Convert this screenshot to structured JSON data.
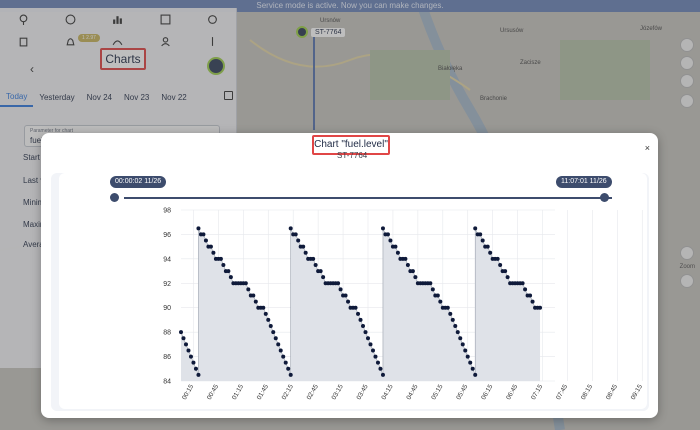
{
  "banner": {
    "text": "Service mode is active. Now you can make changes."
  },
  "map": {
    "labels": [
      "Józefów",
      "Ursnów",
      "Ursusów",
      "Ursów",
      "Ursów Ozarów",
      "Białołęka",
      "Zacisze",
      "Brachonie",
      "Zalesie",
      "Radzymin"
    ],
    "zoom_label": "Zoom"
  },
  "vehicle": {
    "label": "ST-7764"
  },
  "panel": {
    "badge": "1 2.97",
    "title": "Charts",
    "tabs": [
      "Today",
      "Yesterday",
      "Nov 24",
      "Nov 23",
      "Nov 22"
    ],
    "param_label": "Parameter for chart",
    "param_value": "fuel.level",
    "stats": [
      "Start v",
      "Last v",
      "Minim",
      "Maxim",
      "Avera"
    ]
  },
  "modal": {
    "title": "Chart \"fuel.level\"",
    "subtitle": "ST-7764",
    "close": "×",
    "range_start": "00:00:02 11/26",
    "range_end": "11:07:01 11/26"
  },
  "colors": {
    "accent": "#2d77e0",
    "highlight": "#e04646",
    "navy": "#3d4c6d",
    "series": "#0f1a3a",
    "fill": "#dfe2e8"
  },
  "chart_data": {
    "type": "scatter",
    "title": "",
    "xlabel": "",
    "ylabel": "",
    "ylim": [
      84,
      98
    ],
    "yticks": [
      84,
      86,
      88,
      90,
      92,
      94,
      96,
      98
    ],
    "xticks": [
      "00:15",
      "00:45",
      "01:15",
      "01:45",
      "02:15",
      "02:45",
      "03:15",
      "03:45",
      "04:15",
      "04:45",
      "05:15",
      "05:45",
      "06:15",
      "06:45",
      "07:15",
      "07:45",
      "08:15",
      "08:45",
      "09:15",
      "09:45",
      "10:15",
      "10:45"
    ],
    "x_unit": "minutes from 00:00",
    "series": [
      {
        "name": "",
        "points": [
          [
            0,
            88
          ],
          [
            3,
            87.5
          ],
          [
            6,
            87
          ],
          [
            9,
            86.5
          ],
          [
            12,
            86
          ],
          [
            15,
            85.5
          ],
          [
            18,
            85
          ],
          [
            21,
            84.5
          ],
          [
            21,
            96.5
          ],
          [
            24,
            96
          ],
          [
            27,
            96
          ],
          [
            30,
            95.5
          ],
          [
            33,
            95
          ],
          [
            36,
            95
          ],
          [
            39,
            94.5
          ],
          [
            42,
            94
          ],
          [
            45,
            94
          ],
          [
            48,
            94
          ],
          [
            51,
            93.5
          ],
          [
            54,
            93
          ],
          [
            57,
            93
          ],
          [
            60,
            92.5
          ],
          [
            63,
            92
          ],
          [
            66,
            92
          ],
          [
            69,
            92
          ],
          [
            72,
            92
          ],
          [
            75,
            92
          ],
          [
            78,
            92
          ],
          [
            81,
            91.5
          ],
          [
            84,
            91
          ],
          [
            87,
            91
          ],
          [
            90,
            90.5
          ],
          [
            93,
            90
          ],
          [
            96,
            90
          ],
          [
            99,
            90
          ],
          [
            102,
            89.5
          ],
          [
            105,
            89
          ],
          [
            108,
            88.5
          ],
          [
            111,
            88
          ],
          [
            114,
            87.5
          ],
          [
            117,
            87
          ],
          [
            120,
            86.5
          ],
          [
            123,
            86
          ],
          [
            126,
            85.5
          ],
          [
            129,
            85
          ],
          [
            132,
            84.5
          ],
          [
            132,
            96.5
          ],
          [
            135,
            96
          ],
          [
            138,
            96
          ],
          [
            141,
            95.5
          ],
          [
            144,
            95
          ],
          [
            147,
            95
          ],
          [
            150,
            94.5
          ],
          [
            153,
            94
          ],
          [
            156,
            94
          ],
          [
            159,
            94
          ],
          [
            162,
            93.5
          ],
          [
            165,
            93
          ],
          [
            168,
            93
          ],
          [
            171,
            92.5
          ],
          [
            174,
            92
          ],
          [
            177,
            92
          ],
          [
            180,
            92
          ],
          [
            183,
            92
          ],
          [
            186,
            92
          ],
          [
            189,
            92
          ],
          [
            192,
            91.5
          ],
          [
            195,
            91
          ],
          [
            198,
            91
          ],
          [
            201,
            90.5
          ],
          [
            204,
            90
          ],
          [
            207,
            90
          ],
          [
            210,
            90
          ],
          [
            213,
            89.5
          ],
          [
            216,
            89
          ],
          [
            219,
            88.5
          ],
          [
            222,
            88
          ],
          [
            225,
            87.5
          ],
          [
            228,
            87
          ],
          [
            231,
            86.5
          ],
          [
            234,
            86
          ],
          [
            237,
            85.5
          ],
          [
            240,
            85
          ],
          [
            243,
            84.5
          ],
          [
            243,
            96.5
          ],
          [
            246,
            96
          ],
          [
            249,
            96
          ],
          [
            252,
            95.5
          ],
          [
            255,
            95
          ],
          [
            258,
            95
          ],
          [
            261,
            94.5
          ],
          [
            264,
            94
          ],
          [
            267,
            94
          ],
          [
            270,
            94
          ],
          [
            273,
            93.5
          ],
          [
            276,
            93
          ],
          [
            279,
            93
          ],
          [
            282,
            92.5
          ],
          [
            285,
            92
          ],
          [
            288,
            92
          ],
          [
            291,
            92
          ],
          [
            294,
            92
          ],
          [
            297,
            92
          ],
          [
            300,
            92
          ],
          [
            303,
            91.5
          ],
          [
            306,
            91
          ],
          [
            309,
            91
          ],
          [
            312,
            90.5
          ],
          [
            315,
            90
          ],
          [
            318,
            90
          ],
          [
            321,
            90
          ],
          [
            324,
            89.5
          ],
          [
            327,
            89
          ],
          [
            330,
            88.5
          ],
          [
            333,
            88
          ],
          [
            336,
            87.5
          ],
          [
            339,
            87
          ],
          [
            342,
            86.5
          ],
          [
            345,
            86
          ],
          [
            348,
            85.5
          ],
          [
            351,
            85
          ],
          [
            354,
            84.5
          ],
          [
            354,
            96.5
          ],
          [
            357,
            96
          ],
          [
            360,
            96
          ],
          [
            363,
            95.5
          ],
          [
            366,
            95
          ],
          [
            369,
            95
          ],
          [
            372,
            94.5
          ],
          [
            375,
            94
          ],
          [
            378,
            94
          ],
          [
            381,
            94
          ],
          [
            384,
            93.5
          ],
          [
            387,
            93
          ],
          [
            390,
            93
          ],
          [
            393,
            92.5
          ],
          [
            396,
            92
          ],
          [
            399,
            92
          ],
          [
            402,
            92
          ],
          [
            405,
            92
          ],
          [
            408,
            92
          ],
          [
            411,
            92
          ],
          [
            414,
            91.5
          ],
          [
            417,
            91
          ],
          [
            420,
            91
          ],
          [
            423,
            90.5
          ],
          [
            426,
            90
          ],
          [
            429,
            90
          ],
          [
            432,
            90
          ]
        ]
      }
    ]
  }
}
